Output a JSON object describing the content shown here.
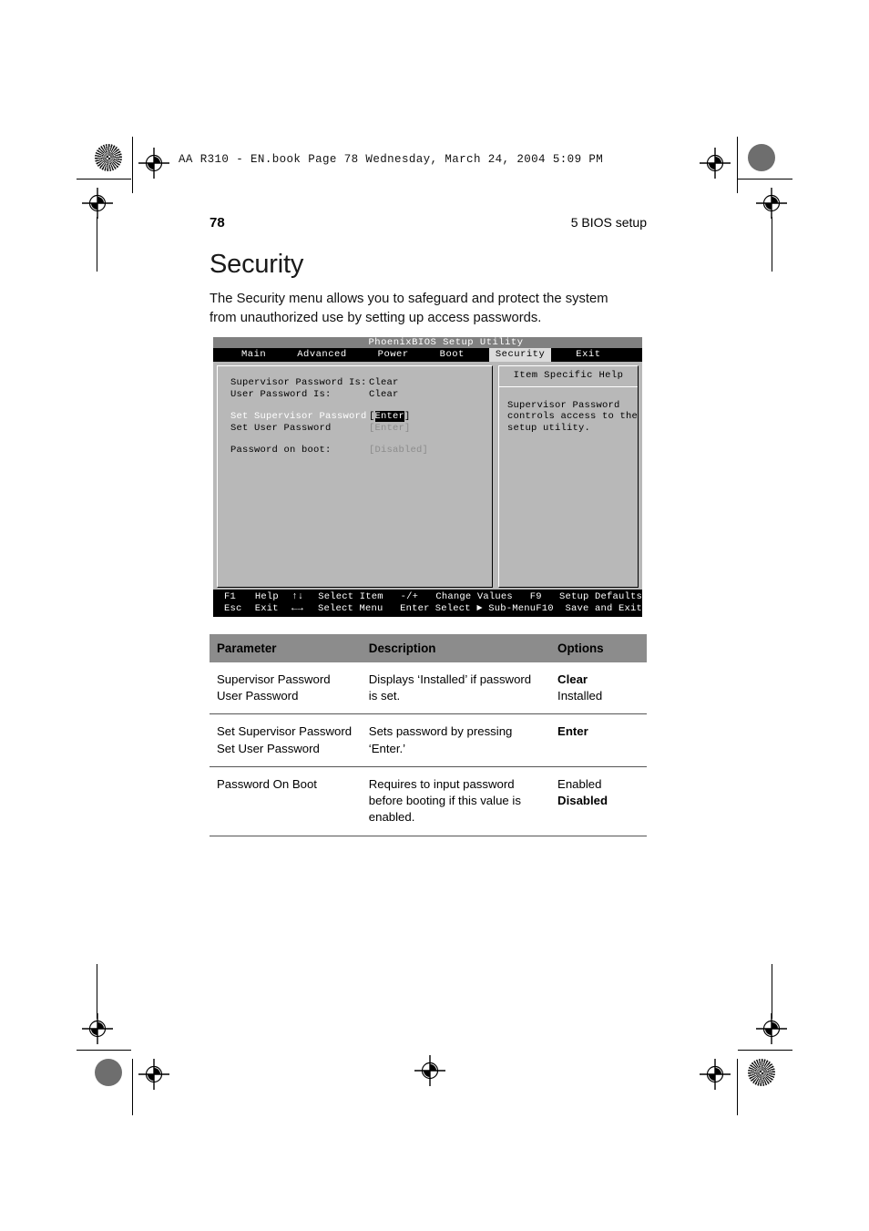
{
  "page": {
    "running_head": "AA R310 - EN.book  Page 78  Wednesday, March 24, 2004  5:09 PM",
    "folio_number": "78",
    "chapter_label": "5 BIOS setup",
    "section_title": "Security",
    "intro_paragraph": "The Security menu allows you to safeguard and protect the system from unauthorized use by setting up access passwords."
  },
  "bios": {
    "title": "PhoenixBIOS Setup Utility",
    "menu": [
      {
        "label": "Main",
        "active": false
      },
      {
        "label": "Advanced",
        "active": false
      },
      {
        "label": "Power",
        "active": false
      },
      {
        "label": "Boot",
        "active": false
      },
      {
        "label": "Security",
        "active": true
      },
      {
        "label": "Exit",
        "active": false
      }
    ],
    "fields": {
      "supervisor_password_is_label": "Supervisor Password Is:",
      "supervisor_password_is_value": "Clear",
      "user_password_is_label": "User Password Is:",
      "user_password_is_value": "Clear",
      "set_supervisor_password_label": "Set Supervisor Password",
      "set_supervisor_password_bracket_open": "[",
      "set_supervisor_password_value": "Enter",
      "set_supervisor_password_bracket_close": "]",
      "set_user_password_label": "Set User Password",
      "set_user_password_value": "[Enter]",
      "password_on_boot_label": "Password on boot:",
      "password_on_boot_value": "[Disabled]"
    },
    "help": {
      "title": "Item Specific Help",
      "line1": "Supervisor Password",
      "line2": "controls access to the",
      "line3": "setup utility."
    },
    "footer": {
      "row1": {
        "key1": "F1",
        "desc1": "Help",
        "key2": "↑↓",
        "desc2": "Select Item",
        "key3": "-/+",
        "desc3": "Change Values",
        "key4": "F9",
        "desc4": "Setup Defaults"
      },
      "row2": {
        "key1": "Esc",
        "desc1": "Exit",
        "key2": "←→",
        "desc2": "Select Menu",
        "key3": "Enter",
        "desc3": "Select ► Sub-Menu",
        "key4": "F10",
        "desc4": "Save and Exit"
      }
    }
  },
  "table": {
    "headers": [
      "Parameter",
      "Description",
      "Options"
    ],
    "rows": [
      {
        "parameter": [
          "Supervisor Password",
          "User Password"
        ],
        "description": "Displays ‘Installed’ if password is set.",
        "options": [
          {
            "text": "Clear",
            "bold": true
          },
          {
            "text": "Installed",
            "bold": false
          }
        ]
      },
      {
        "parameter": [
          "Set Supervisor Password",
          "Set User Password"
        ],
        "description": "Sets password by pressing ‘Enter.’",
        "options": [
          {
            "text": "Enter",
            "bold": true
          }
        ]
      },
      {
        "parameter": [
          "Password On Boot"
        ],
        "description": "Requires to input password before booting if this value is enabled.",
        "options": [
          {
            "text": "Enabled",
            "bold": false
          },
          {
            "text": "Disabled",
            "bold": true
          }
        ]
      }
    ]
  },
  "colors": {
    "bios_background": "#b8b8b8",
    "bios_menubar": "#000000",
    "bios_titlebar": "#808080",
    "table_header": "#8c8c8c",
    "page_background": "#ffffff"
  }
}
